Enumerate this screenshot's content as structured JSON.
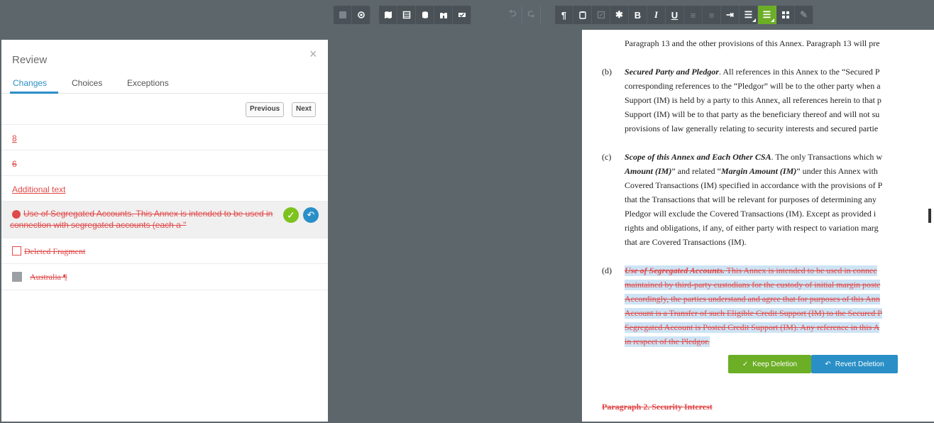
{
  "review": {
    "title": "Review",
    "close": "×",
    "tabs": [
      "Changes",
      "Choices",
      "Exceptions"
    ],
    "previous": "Previous",
    "next": "Next",
    "changes": [
      {
        "text": "8",
        "kind": "insert"
      },
      {
        "text": "6",
        "kind": "delete"
      },
      {
        "text": "Additional text",
        "kind": "insert"
      },
      {
        "text_line1": "Use of Segregated Accounts.  This Annex is intended to be used in",
        "text_line2": "connection with segregated accounts (each a \"",
        "kind": "delete"
      },
      {
        "text": "Deleted  Fragment",
        "kind": "delete"
      },
      {
        "text": "Australia ¶",
        "kind": "delete"
      }
    ]
  },
  "document": {
    "p_top": "Paragraph 13 and the other provisions of this Annex. Paragraph 13 will pre",
    "b_label": "(b)",
    "b_title": "Secured Party and Pledgor",
    "b_lines": [
      ". All references in this Annex to the “Secured P",
      "corresponding references to the “Pledgor” will be to the other party when a",
      "Support (IM) is held by a party to this Annex, all references herein to that p",
      "Support (IM) will be to that party as the beneficiary thereof and will not su",
      "provisions of law generally relating to security interests and secured partie"
    ],
    "c_label": "(c)",
    "c_title": "Scope of this Annex and Each Other CSA",
    "c_lines": [
      ". The only Transactions which w",
      "” and related “",
      "” under this Annex with",
      "Covered Transactions (IM) specified in accordance with the provisions of P",
      "that the Transactions that will be relevant for purposes of determining any",
      "Pledgor will exclude the Covered Transactions (IM).  Except as provided i",
      "rights and obligations, if any, of either party with respect to variation marg",
      "that are Covered Transactions (IM)."
    ],
    "c_bold1": "Amount (IM)",
    "c_bold2": "Margin Amount (IM)",
    "d_label": "(d)",
    "d_title": "Use of Segregated Accounts.",
    "d_lines": [
      "  This Annex is intended to be used in connec",
      "maintained by third-party custodians for the custody of initial margin poste",
      "Accordingly, the parties understand and agree that for purposes of this Ann",
      "Account is a Transfer of such Eligible Credit Support (IM) to the Secured P",
      "Segregated Account is Posted Credit Support (IM).  Any reference in this A",
      "in respect of the Pledgor."
    ],
    "keep_label": "Keep Deletion",
    "revert_label": "Revert Deletion",
    "para2": "Paragraph 2. Security Interest"
  },
  "colors": {
    "accent_blue": "#2a8fc7",
    "green": "#6cae25",
    "red": "#e04a4a",
    "highlight": "#cde4f5"
  }
}
